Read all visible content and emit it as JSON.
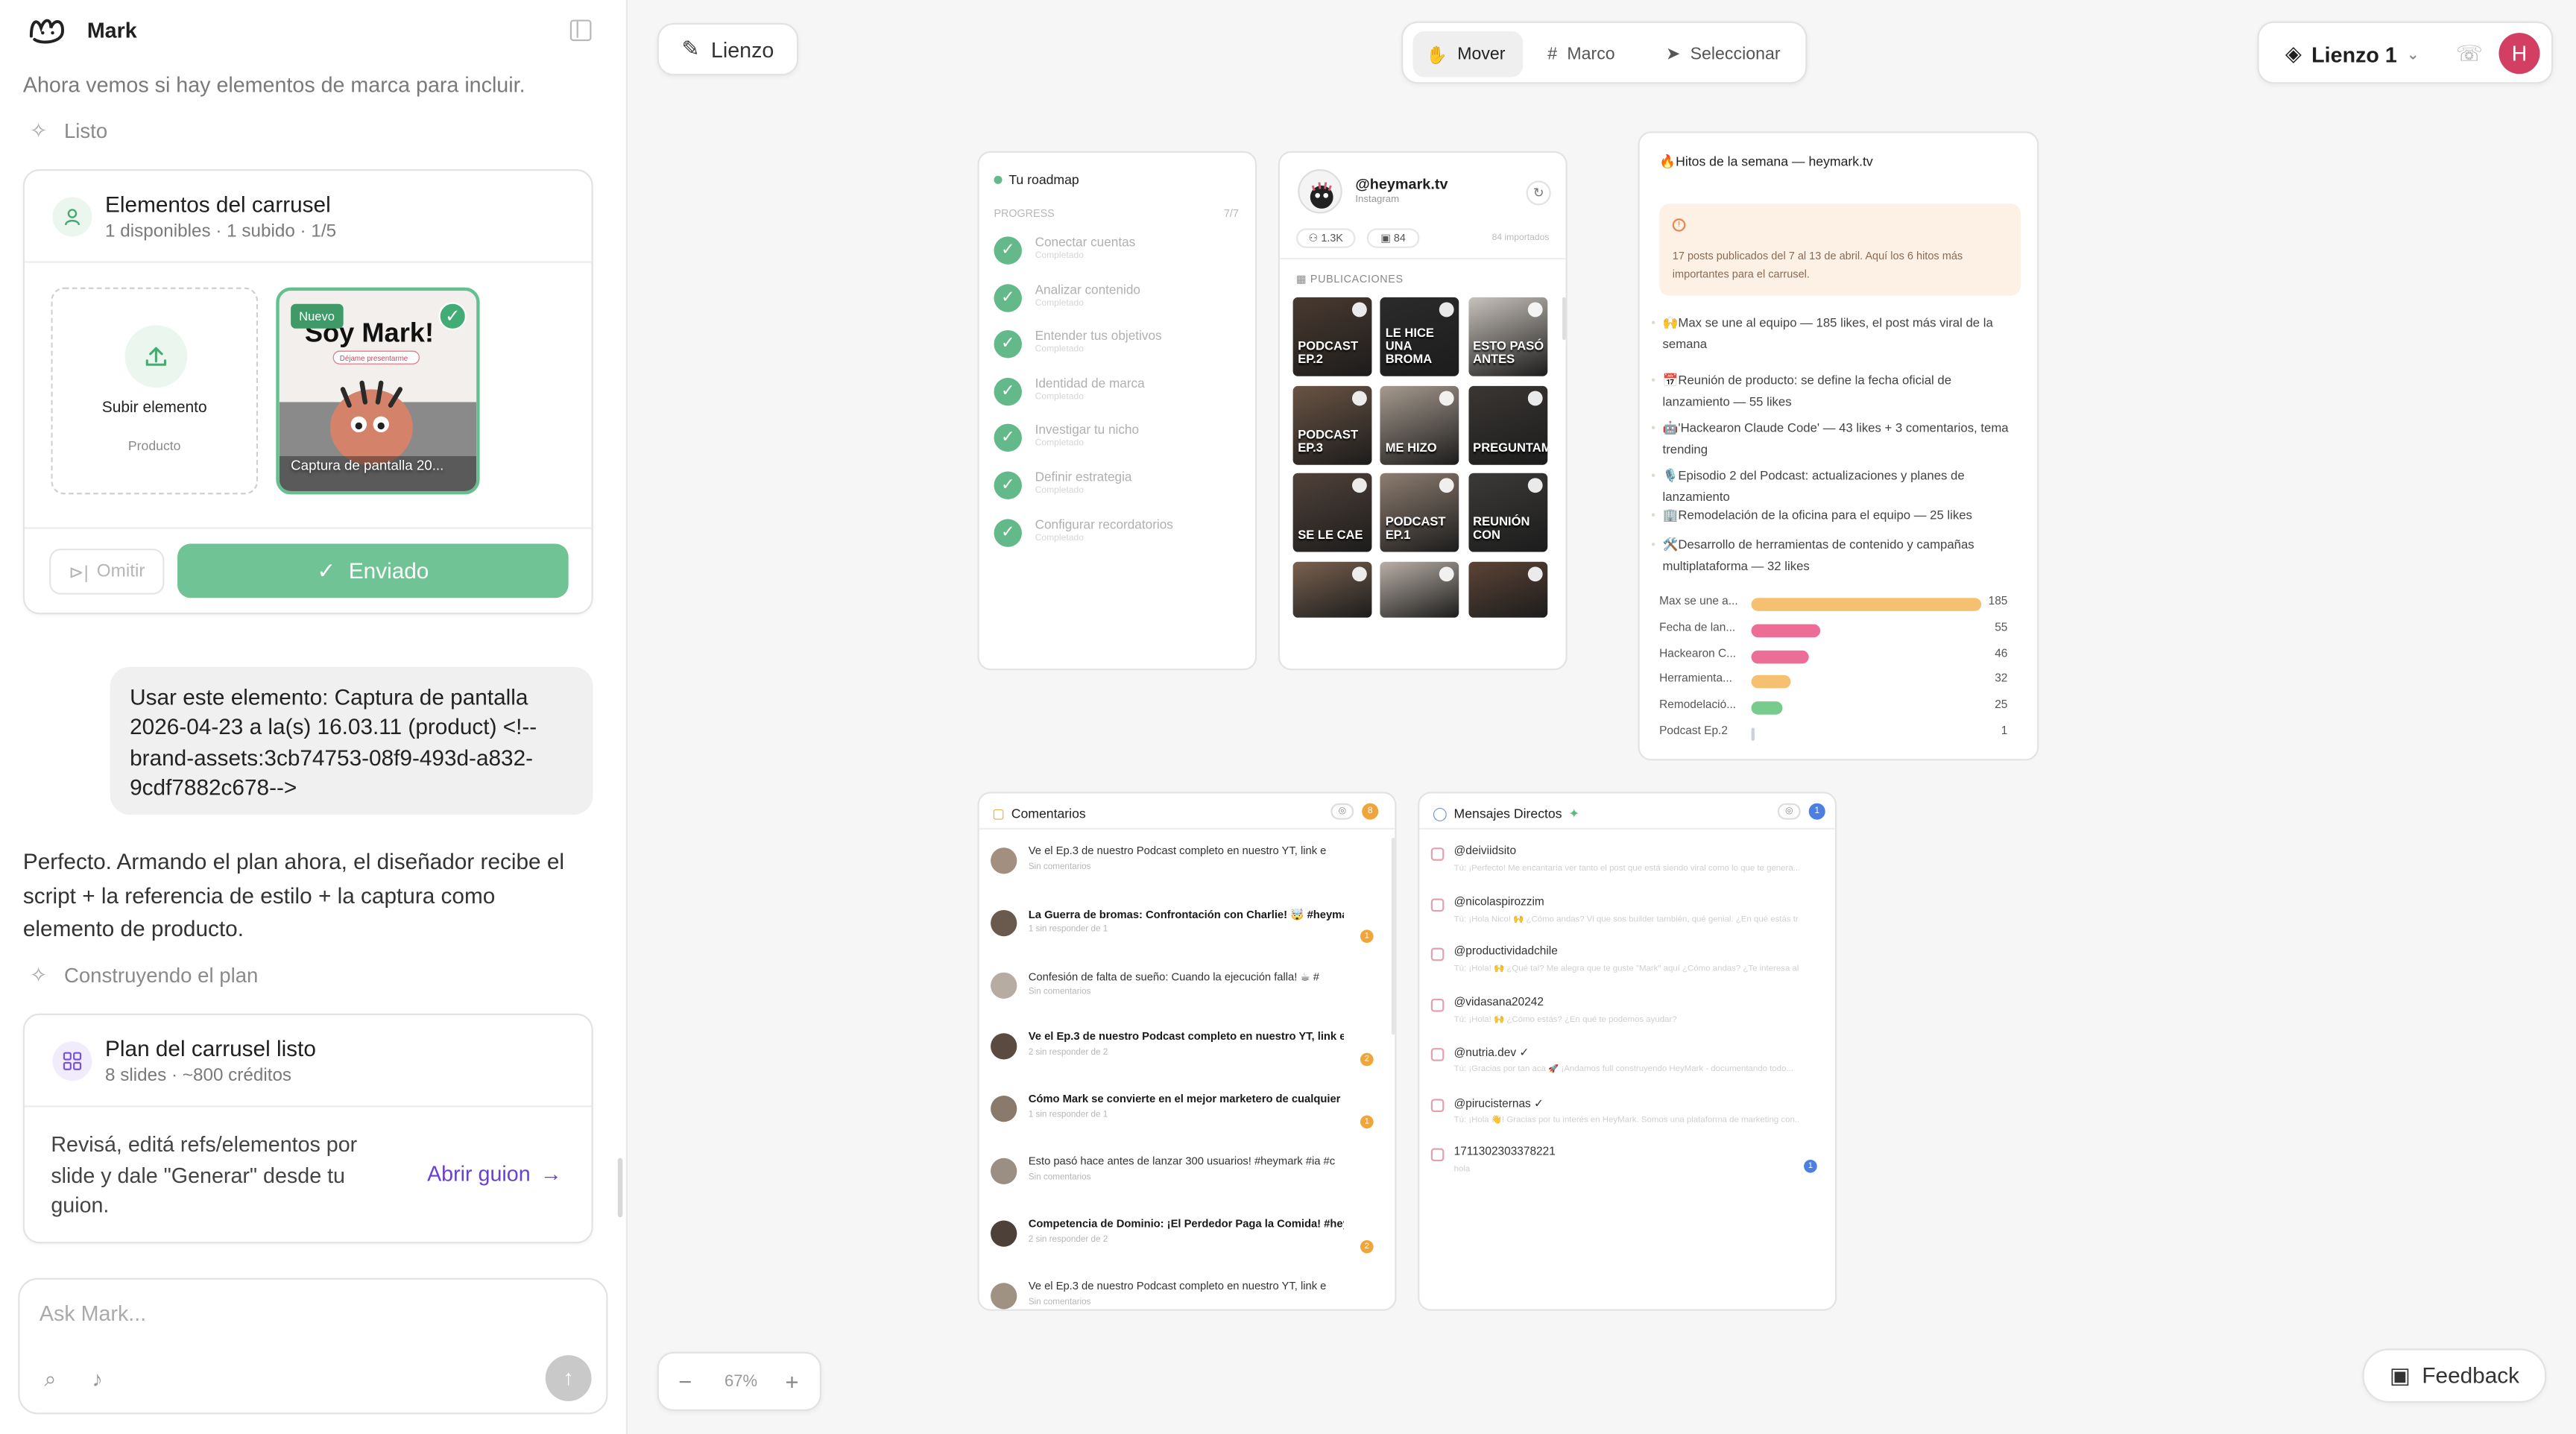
{
  "app": {
    "name": "Mark"
  },
  "chat": {
    "msg_marca": "Ahora vemos si hay elementos de marca para incluir.",
    "step_listo": "Listo",
    "carousel": {
      "title": "Elementos del carrusel",
      "subtitle": "1 disponibles · 1 subido · 1/5",
      "upload_label": "Subir elemento",
      "upload_sub": "Producto",
      "asset_badge": "Nuevo",
      "asset_headline": "Soy Mark!",
      "asset_tagline": "Déjame presentarme",
      "asset_caption": "Captura de pantalla 20...",
      "skip_label": "Omitir",
      "sent_label": "Enviado"
    },
    "user_message": "Usar este elemento: Captura de pantalla 2026-04-23 a la(s) 16.03.11 (product) <!--brand-assets:3cb74753-08f9-493d-a832-9cdf7882c678-->",
    "assistant_message": "Perfecto. Armando el plan ahora, el diseñador recibe el script + la referencia de estilo + la captura como elemento de producto.",
    "step_construyendo": "Construyendo el plan",
    "plan": {
      "title": "Plan del carrusel listo",
      "subtitle": "8 slides · ~800 créditos",
      "body": "Revisá, editá refs/elementos por slide y dale \"Generar\" desde tu guion.",
      "link": "Abrir guion"
    },
    "composer_placeholder": "Ask Mark..."
  },
  "canvas": {
    "canvas_label": "Lienzo",
    "tools": [
      {
        "label": "Mover"
      },
      {
        "label": "Marco"
      },
      {
        "label": "Seleccionar"
      }
    ],
    "canvas_name": "Lienzo 1",
    "avatar_initial": "H",
    "zoom": "67%",
    "feedback": "Feedback"
  },
  "roadmap": {
    "title": "Tu roadmap",
    "progress_label": "PROGRESS",
    "progress_count": "7/7",
    "items": [
      {
        "label": "Conectar cuentas",
        "state": "Completado"
      },
      {
        "label": "Analizar contenido",
        "state": "Completado"
      },
      {
        "label": "Entender tus objetivos",
        "state": "Completado"
      },
      {
        "label": "Identidad de marca",
        "state": "Completado"
      },
      {
        "label": "Investigar tu nicho",
        "state": "Completado"
      },
      {
        "label": "Definir estrategia",
        "state": "Completado"
      },
      {
        "label": "Configurar recordatorios",
        "state": "Completado"
      }
    ]
  },
  "instagram": {
    "handle": "@heymark.tv",
    "platform": "Instagram",
    "followers": "1.3K",
    "posts": "84",
    "imported": "84 importados",
    "section": "PUBLICACIONES",
    "thumbs": [
      "PODCAST EP.2",
      "LE HICE UNA BROMA",
      "ESTO PASÓ ANTES",
      "PODCAST EP.3",
      "ME HIZO",
      "PREGUNTAMOS",
      "SE LE CAE",
      "PODCAST EP.1",
      "REUNIÓN CON",
      "",
      "",
      ""
    ]
  },
  "hitos": {
    "title": "🔥Hitos de la semana — heymark.tv",
    "info": "17 posts publicados del 7 al 13 de abril. Aquí los 6 hitos más importantes para el carrusel.",
    "items": [
      "🙌Max se une al equipo — 185 likes, el post más viral de la semana",
      "📅Reunión de producto: se define la fecha oficial de lanzamiento — 55 likes",
      "🤖'Hackearon Claude Code' — 43 likes + 3 comentarios, tema trending",
      "🎙️Episodio 2 del Podcast: actualizaciones y planes de lanzamiento",
      "🏢Remodelación de la oficina para el equipo — 25 likes",
      "🛠️Desarrollo de herramientas de contenido y campañas multiplataforma — 32 likes"
    ]
  },
  "chart_data": {
    "type": "bar",
    "orientation": "horizontal",
    "categories": [
      "Max se une a...",
      "Fecha de lan...",
      "Hackearon C...",
      "Herramienta...",
      "Remodelació...",
      "Podcast Ep.2"
    ],
    "values": [
      185,
      55,
      46,
      32,
      25,
      1
    ],
    "colors": [
      "#f5c170",
      "#ec6d96",
      "#ec6d96",
      "#f5c170",
      "#77cb8c",
      "#ccd2dd"
    ],
    "xlim": [
      0,
      185
    ]
  },
  "comentarios": {
    "title": "Comentarios",
    "count": "8",
    "rows": [
      {
        "text": "Ve el Ep.3 de nuestro Podcast completo en nuestro YT, link e",
        "sub": "Sin comentarios",
        "bold": false,
        "badge": ""
      },
      {
        "text": "La Guerra de bromas: Confrontación con Charlie! 🤯 #heyma...",
        "sub": "1 sin responder de 1",
        "bold": true,
        "badge": "1"
      },
      {
        "text": "Confesión de falta de sueño: Cuando la ejecución falla! ☕ #",
        "sub": "Sin comentarios",
        "bold": false,
        "badge": ""
      },
      {
        "text": "Ve el Ep.3 de nuestro Podcast completo en nuestro YT, link e",
        "sub": "2 sin responder de 2",
        "bold": true,
        "badge": "2"
      },
      {
        "text": "Cómo Mark se convierte en el mejor marketero de cualquier ni",
        "sub": "1 sin responder de 1",
        "bold": true,
        "badge": "1"
      },
      {
        "text": "Esto pasó hace antes de lanzar 300 usuarios! #heymark #ia #c",
        "sub": "Sin comentarios",
        "bold": false,
        "badge": ""
      },
      {
        "text": "Competencia de Dominio: ¡El Perdedor Paga la Comida! #hey...",
        "sub": "2 sin responder de 2",
        "bold": true,
        "badge": "2"
      },
      {
        "text": "Ve el Ep.3 de nuestro Podcast completo en nuestro YT, link e",
        "sub": "Sin comentarios",
        "bold": false,
        "badge": ""
      }
    ]
  },
  "mensajes": {
    "title": "Mensajes Directos",
    "count": "1",
    "rows": [
      {
        "user": "@deiviidsito",
        "preview": "Tú: ¡Perfecto! Me encantaría ver tanto el post que está siendo viral como lo que te genera..."
      },
      {
        "user": "@nicolaspirozzim",
        "preview": "Tú: ¡Hola Nico! 🙌 ¿Cómo andas? Vi que sos builder también, qué genial. ¿En qué estás tr..."
      },
      {
        "user": "@productividadchile",
        "preview": "Tú: ¡Hola! 🙌 ¿Qué tal? Me alegra que te guste \"Mark\" aquí ¿Cómo andas? ¿Te interesa algo en part..."
      },
      {
        "user": "@vidasana20242",
        "preview": "Tú: ¡Hola! 🙌 ¿Cómo estás? ¿En qué te podemos ayudar?"
      },
      {
        "user": "@nutria.dev ✓",
        "preview": "Tú: ¡Gracias por tan aca 🚀 ¡Andamos full construyendo HeyMark - documentando todo..."
      },
      {
        "user": "@pirucisternas ✓",
        "preview": "Tú: ¡Hola 👋! Gracias por tu interés en HeyMark. Somos una plataforma de marketing con..."
      },
      {
        "user": "17113023033782​21",
        "preview": "hola"
      }
    ]
  }
}
